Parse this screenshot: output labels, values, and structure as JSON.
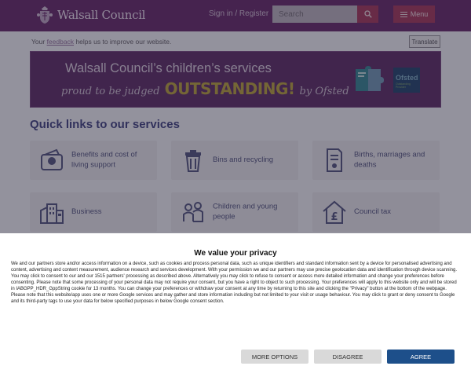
{
  "header": {
    "logo_text": "Walsall Council",
    "signin_label": "Sign in / Register",
    "search_placeholder": "Search",
    "menu_label": "Menu"
  },
  "feedback": {
    "prefix": "Your",
    "link_text": "feedback",
    "suffix": "helps us to improve our website.",
    "translate_label": "Translate"
  },
  "banner": {
    "title": "Walsall Council’s children’s services",
    "proud": "proud to be judged",
    "outstanding": "OUTSTANDING!",
    "by_ofsted": "by Ofsted",
    "ofsted_badge_name": "Ofsted",
    "ofsted_badge_grade": "Outstanding Provider"
  },
  "quick_links": {
    "heading": "Quick links to our services",
    "items": [
      {
        "label": "Benefits and cost of living support",
        "icon": "wallet-icon"
      },
      {
        "label": "Bins and recycling",
        "icon": "bin-icon"
      },
      {
        "label": "Births, marriages and deaths",
        "icon": "certificate-icon"
      },
      {
        "label": "Business",
        "icon": "buildings-icon"
      },
      {
        "label": "Children and young people",
        "icon": "children-icon"
      },
      {
        "label": "Council tax",
        "icon": "house-pound-icon"
      }
    ]
  },
  "consent": {
    "title": "We value your privacy",
    "paragraph_1": "We and our partners store and/or access information on a device, such as cookies and process personal data, such as unique identifiers and standard information sent by a device for personalised advertising and content, advertising and content measurement, audience research and services development. With your permission we and our partners may use precise geolocation data and identification through device scanning. You may click to consent to our and our 1515 partners' processing as described above. Alternatively you may click to refuse to consent or access more detailed information and change your preferences before consenting. Please note that some processing of your personal data may not require your consent, but you have a right to object to such processing. Your preferences will apply to this website only and will be stored in IABGPP_HDR_GppString cookie for 13 months. You can change your preferences or withdraw your consent at any time by returning to this site and clicking the \"Privacy\" button at the bottom of the webpage.",
    "paragraph_2": "Please note that this website/app uses one or more Google services and may gather and store information including but not limited to your visit or usage behaviour. You may click to grant or deny consent to Google and its third-party tags to use your data for below specified purposes in below Google consent section.",
    "more_options_label": "MORE OPTIONS",
    "disagree_label": "DISAGREE",
    "agree_label": "AGREE"
  },
  "colors": {
    "header_bg": "#5f1f63",
    "accent": "#9d2f55",
    "heading": "#3a3a7a",
    "agree_bg": "#1d4f8a"
  }
}
